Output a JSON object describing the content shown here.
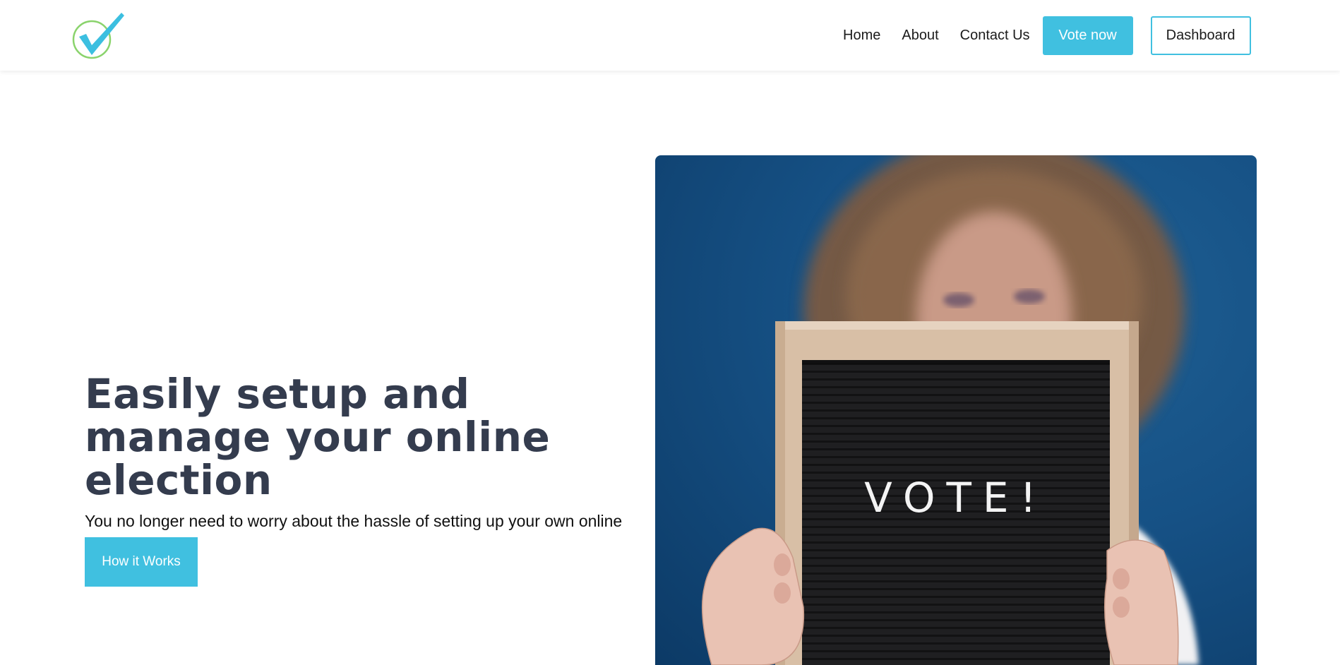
{
  "nav": {
    "links": [
      "Home",
      "About",
      "Contact Us"
    ],
    "vote_label": "Vote now",
    "dashboard_label": "Dashboard"
  },
  "hero": {
    "title": "Easily setup and manage your online election",
    "subtitle": "You no longer need to worry about the hassle of setting up your own online election.",
    "cta_label": "How it Works",
    "image_sign_text": "VOTE!"
  },
  "colors": {
    "accent": "#40c0e0",
    "heading": "#343c4e",
    "logo_circle": "#8ad36c"
  },
  "icons": {
    "logo": "checkmark-circle-logo"
  }
}
